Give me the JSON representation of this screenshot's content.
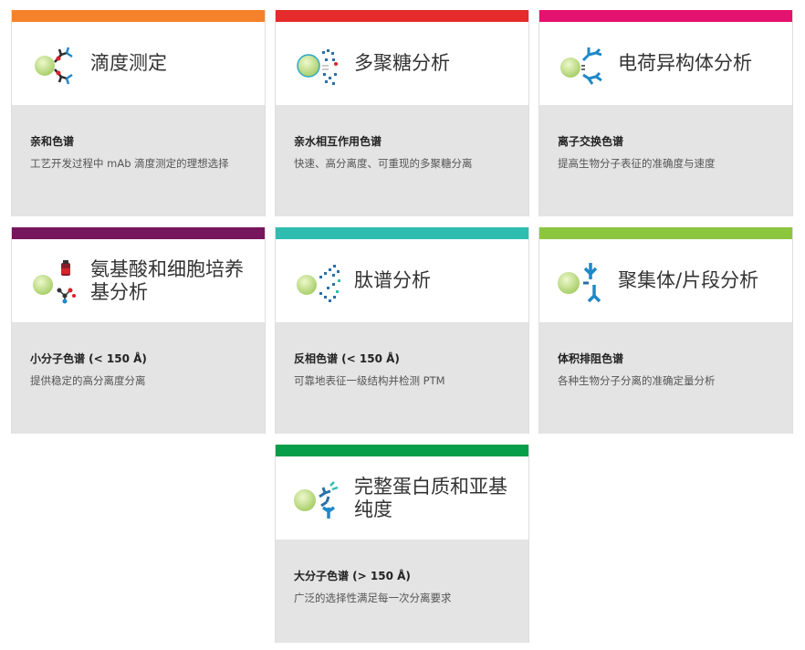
{
  "colors": {
    "orange": "#f5822a",
    "red": "#e52b2b",
    "magenta": "#e4136f",
    "purple": "#76165d",
    "teal": "#2fbdb0",
    "green": "#8cc63f",
    "dark_green": "#069e48"
  },
  "cards": [
    {
      "title": "滴度测定",
      "subtitle": "亲和色谱",
      "description": "工艺开发过程中 mAb 滴度测定的理想选择",
      "color": "orange",
      "icon": "antibody-binding-icon"
    },
    {
      "title": "多聚糖分析",
      "subtitle": "亲水相互作用色谱",
      "description": "快速、高分离度、可重现的多聚糖分离",
      "color": "red",
      "icon": "glycan-icon"
    },
    {
      "title": "电荷异构体分析",
      "subtitle": "离子交换色谱",
      "description": "提高生物分子表征的准确度与速度",
      "color": "magenta",
      "icon": "charge-variant-icon"
    },
    {
      "title": "氨基酸和细胞培养基分析",
      "subtitle": "小分子色谱 (< 150 Å)",
      "description": "提供稳定的高分离度分离",
      "color": "purple",
      "icon": "amino-acid-icon"
    },
    {
      "title": "肽谱分析",
      "subtitle": "反相色谱 (< 150 Å)",
      "description": "可靠地表征一级结构并检测 PTM",
      "color": "teal",
      "icon": "peptide-map-icon"
    },
    {
      "title": "聚集体/片段分析",
      "subtitle": "体积排阻色谱",
      "description": "各种生物分子分离的准确定量分析",
      "color": "green",
      "icon": "aggregate-icon"
    },
    {
      "title": "完整蛋白质和亚基纯度",
      "subtitle": "大分子色谱 (> 150 Å)",
      "description": "广泛的选择性满足每一次分离要求",
      "color": "dark_green",
      "icon": "intact-protein-icon"
    }
  ]
}
